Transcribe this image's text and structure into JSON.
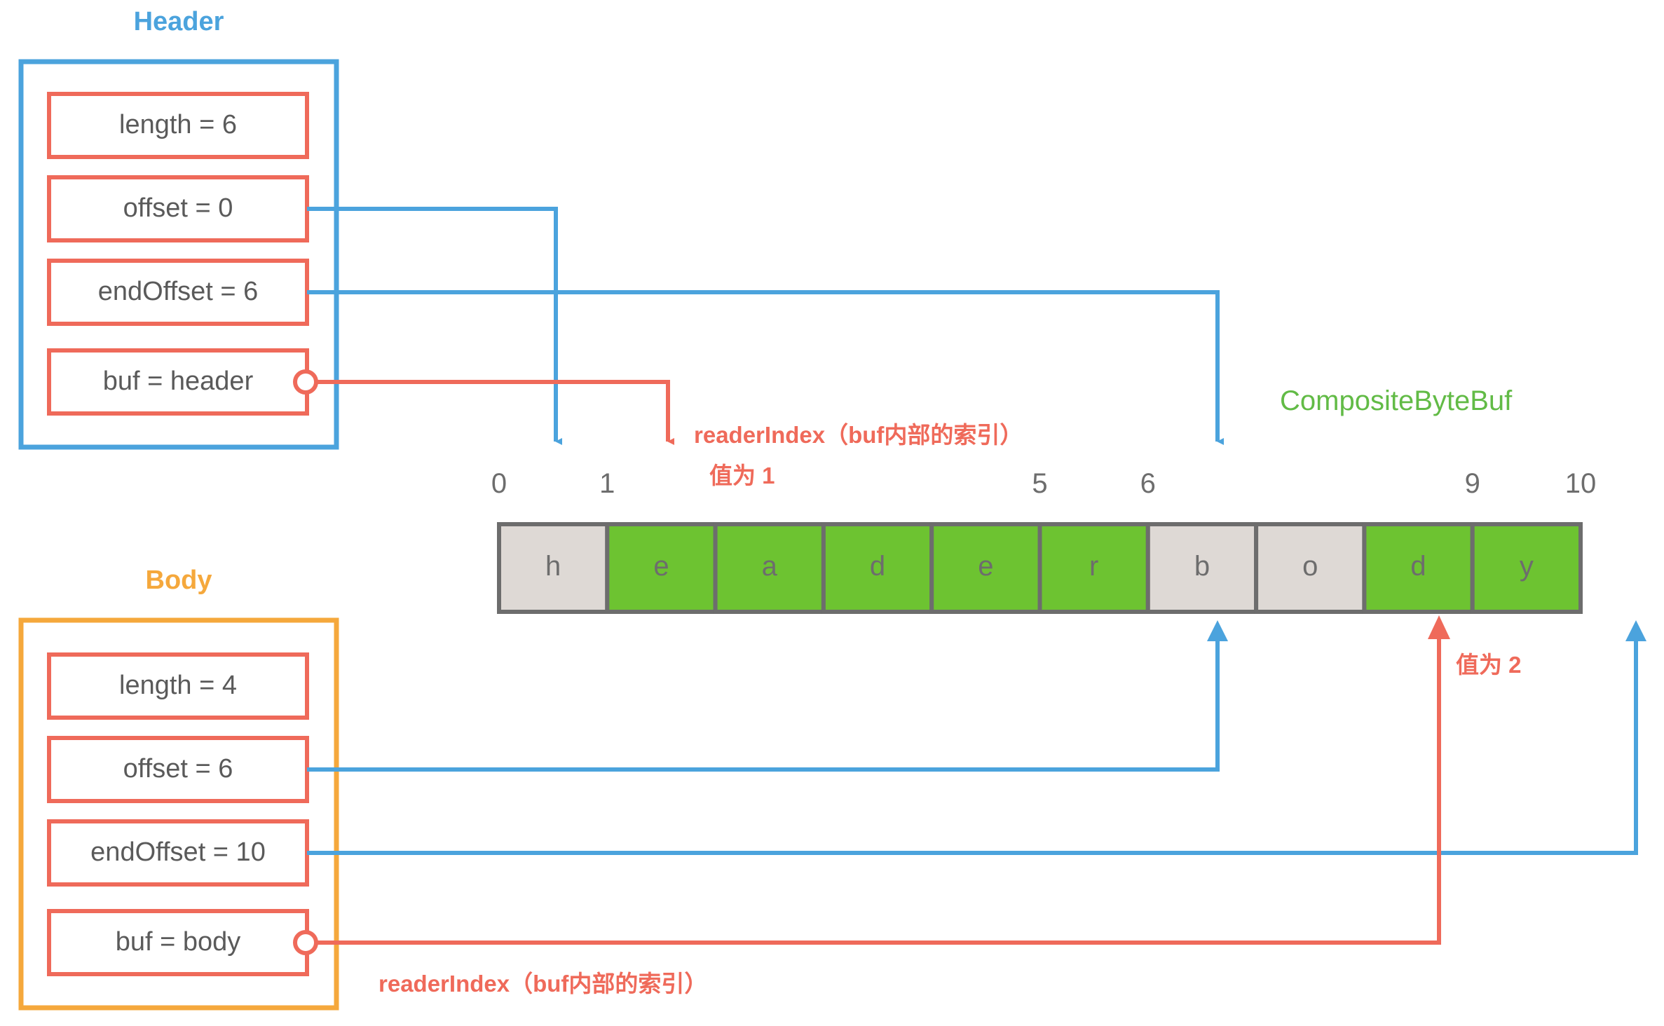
{
  "colors": {
    "blue": "#4ba3dd",
    "red": "#ef6a5a",
    "orange": "#f5a council",
    "orange_real": "#f5a83c",
    "green": "#6dc331",
    "gray_cell": "#ded9d5",
    "cell_border": "#6d6d6d",
    "text_gray": "#5a5a5a",
    "green_text": "#62bb46"
  },
  "header_group": {
    "title": "Header",
    "fields": [
      {
        "label": "length = 6"
      },
      {
        "label": "offset = 0"
      },
      {
        "label": "endOffset = 6"
      },
      {
        "label": "buf = header"
      }
    ]
  },
  "body_group": {
    "title": "Body",
    "fields": [
      {
        "label": "length = 4"
      },
      {
        "label": "offset = 6"
      },
      {
        "label": "endOffset = 10"
      },
      {
        "label": "buf = body"
      }
    ]
  },
  "composite": {
    "title": "CompositeByteBuf",
    "cells": [
      {
        "char": "h",
        "state": "read"
      },
      {
        "char": "e",
        "state": "unread"
      },
      {
        "char": "a",
        "state": "unread"
      },
      {
        "char": "d",
        "state": "unread"
      },
      {
        "char": "e",
        "state": "unread"
      },
      {
        "char": "r",
        "state": "unread"
      },
      {
        "char": "b",
        "state": "read"
      },
      {
        "char": "o",
        "state": "read"
      },
      {
        "char": "d",
        "state": "unread"
      },
      {
        "char": "y",
        "state": "unread"
      }
    ],
    "ticks": [
      {
        "value": "0",
        "index": 0
      },
      {
        "value": "1",
        "index": 1
      },
      {
        "value": "5",
        "index": 5
      },
      {
        "value": "6",
        "index": 6
      },
      {
        "value": "9",
        "index": 9
      },
      {
        "value": "10",
        "index": 10
      }
    ]
  },
  "annotations": {
    "header_reader_index": "readerIndex（buf内部的索引）",
    "header_reader_value": "值为 1",
    "body_reader_value": "值为 2",
    "body_reader_index": "readerIndex（buf内部的索引）"
  }
}
